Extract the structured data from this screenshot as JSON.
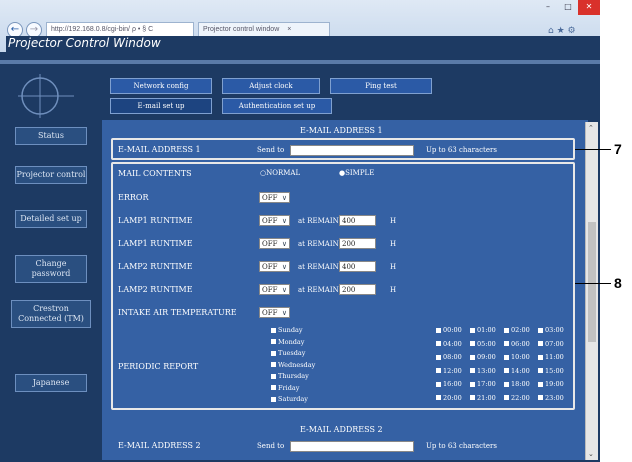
{
  "browser": {
    "address": "http://192.168.0.8/cgi-bin/ ρ • § C",
    "tab_title": "Projector control window",
    "tab_close": "×"
  },
  "window": {
    "title": "Projector Control Window"
  },
  "nav": [
    "Status",
    "Projector control",
    "Detailed set up",
    "Change password",
    "Crestron Connected (TM)",
    "Japanese"
  ],
  "tabs": [
    "Network config",
    "Adjust clock",
    "Ping test",
    "E-mail set up",
    "Authentication set up"
  ],
  "section1": {
    "header": "E-MAIL ADDRESS 1",
    "label": "E-MAIL ADDRESS 1",
    "send_to": "Send to",
    "hint": "Up to 63 characters"
  },
  "mail_contents": {
    "label": "MAIL CONTENTS",
    "normal": "NORMAL",
    "simple": "SIMPLE"
  },
  "error": {
    "label": "ERROR",
    "value": "OFF"
  },
  "lamps": [
    {
      "label": "LAMP1 RUNTIME",
      "value": "OFF",
      "remain_label": "at REMAIN",
      "remain": "400",
      "unit": "H"
    },
    {
      "label": "LAMP1 RUNTIME",
      "value": "OFF",
      "remain_label": "at REMAIN",
      "remain": "200",
      "unit": "H"
    },
    {
      "label": "LAMP2 RUNTIME",
      "value": "OFF",
      "remain_label": "at REMAIN",
      "remain": "400",
      "unit": "H"
    },
    {
      "label": "LAMP2 RUNTIME",
      "value": "OFF",
      "remain_label": "at REMAIN",
      "remain": "200",
      "unit": "H"
    }
  ],
  "intake": {
    "label": "INTAKE AIR TEMPERATURE",
    "value": "OFF"
  },
  "periodic": {
    "label": "PERIODIC REPORT",
    "days": [
      "Sunday",
      "Monday",
      "Tuesday",
      "Wednesday",
      "Thursday",
      "Friday",
      "Saturday"
    ],
    "times": [
      "00:00",
      "01:00",
      "02:00",
      "03:00",
      "04:00",
      "05:00",
      "06:00",
      "07:00",
      "08:00",
      "09:00",
      "10:00",
      "11:00",
      "12:00",
      "13:00",
      "14:00",
      "15:00",
      "16:00",
      "17:00",
      "18:00",
      "19:00",
      "20:00",
      "21:00",
      "22:00",
      "23:00"
    ]
  },
  "section2": {
    "header": "E-MAIL ADDRESS 2",
    "label": "E-MAIL ADDRESS 2",
    "send_to": "Send to",
    "hint": "Up to 63 characters"
  },
  "callouts": {
    "a": "7",
    "b": "8"
  }
}
